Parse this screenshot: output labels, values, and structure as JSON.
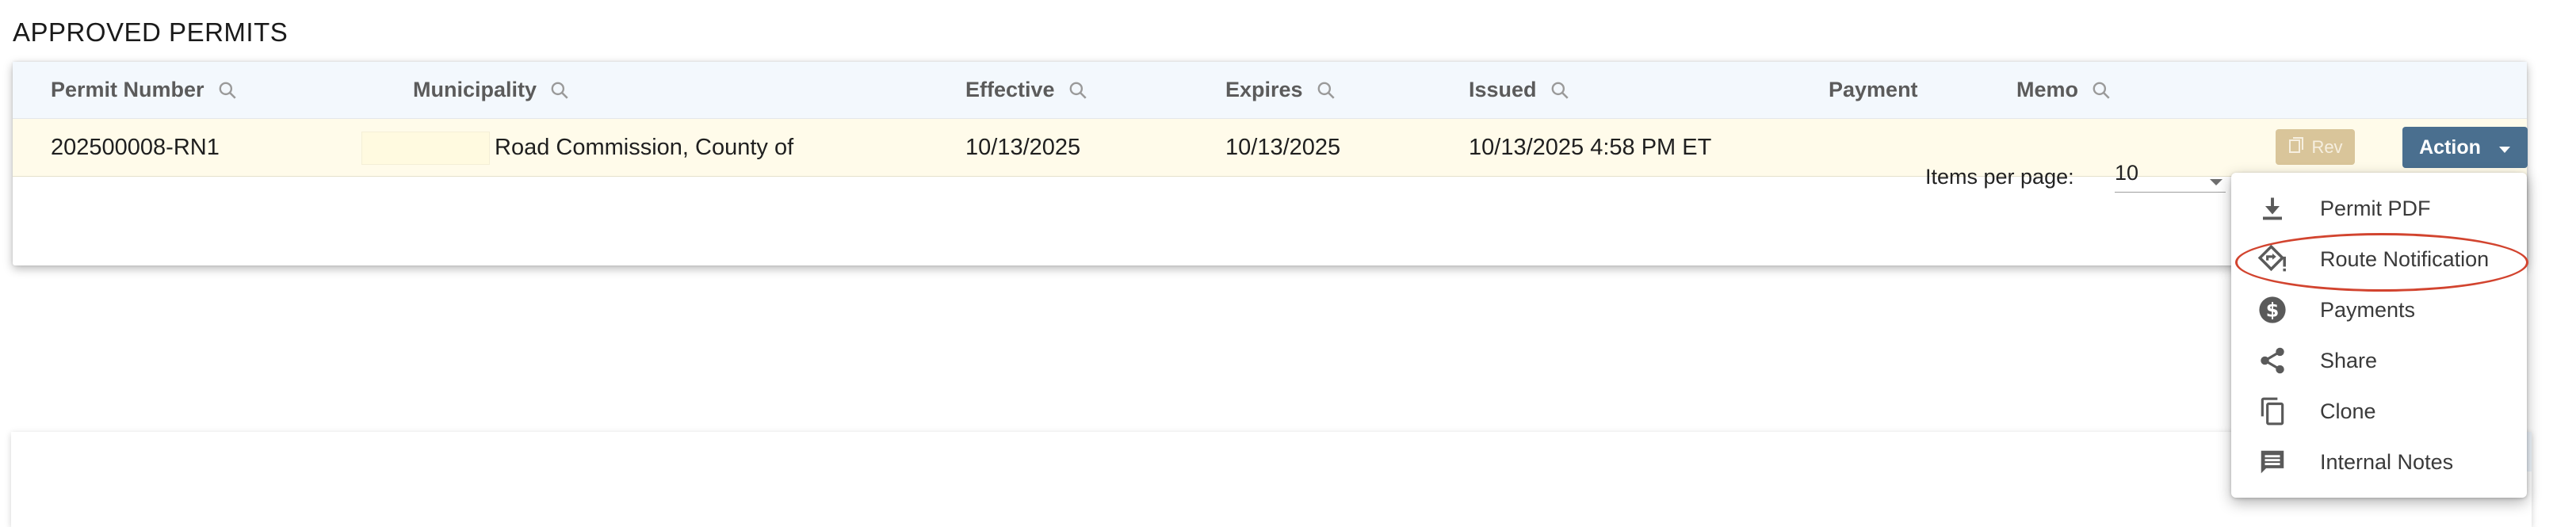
{
  "page": {
    "title": "APPROVED PERMITS"
  },
  "table": {
    "columns": [
      "Permit Number",
      "Municipality",
      "Effective",
      "Expires",
      "Issued",
      "Payment",
      "Memo"
    ],
    "row": {
      "permit_number": "202500008-RN1",
      "municipality": "Road Commission, County of",
      "effective": "10/13/2025",
      "expires": "10/13/2025",
      "issued": "10/13/2025 4:58 PM ET",
      "payment": "",
      "memo": ""
    },
    "rev_label": "Rev",
    "action_label": "Action"
  },
  "paginator": {
    "items_per_page_label": "Items per page:",
    "items_per_page_value": "10"
  },
  "action_menu": {
    "items": [
      {
        "label": "Permit PDF",
        "icon": "download-icon"
      },
      {
        "label": "Route Notification",
        "icon": "route-icon"
      },
      {
        "label": "Payments",
        "icon": "dollar-icon"
      },
      {
        "label": "Share",
        "icon": "share-icon"
      },
      {
        "label": "Clone",
        "icon": "copy-icon"
      },
      {
        "label": "Internal Notes",
        "icon": "comment-icon"
      }
    ],
    "highlighted_item": "Route Notification"
  },
  "colors": {
    "header_bg": "#f3f8fd",
    "row_bg": "#fffbea",
    "action_button": "#4a6f8f",
    "rev_button": "#d9c59a",
    "highlight": "#d2442f"
  }
}
